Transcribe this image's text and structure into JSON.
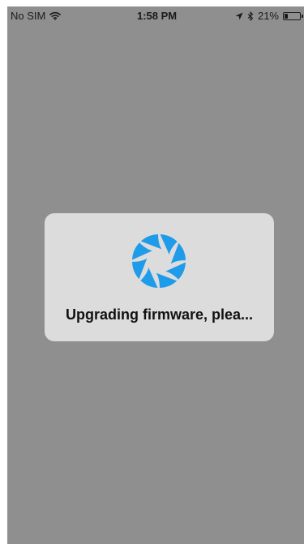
{
  "status_bar": {
    "carrier": "No SIM",
    "time": "1:58 PM",
    "battery_percent": "21%",
    "battery_level": 0.21,
    "icons": [
      "wifi-icon",
      "location-arrow-icon",
      "bluetooth-icon",
      "battery-icon"
    ]
  },
  "dialog": {
    "message": "Upgrading firmware, plea...",
    "spinner_icon": "loading-spinner-icon",
    "spinner_color": "#1e9be9"
  },
  "colors": {
    "overlay": "#8f8f8f",
    "dialog_background": "#dcdcdc",
    "accent": "#1e9be9"
  }
}
